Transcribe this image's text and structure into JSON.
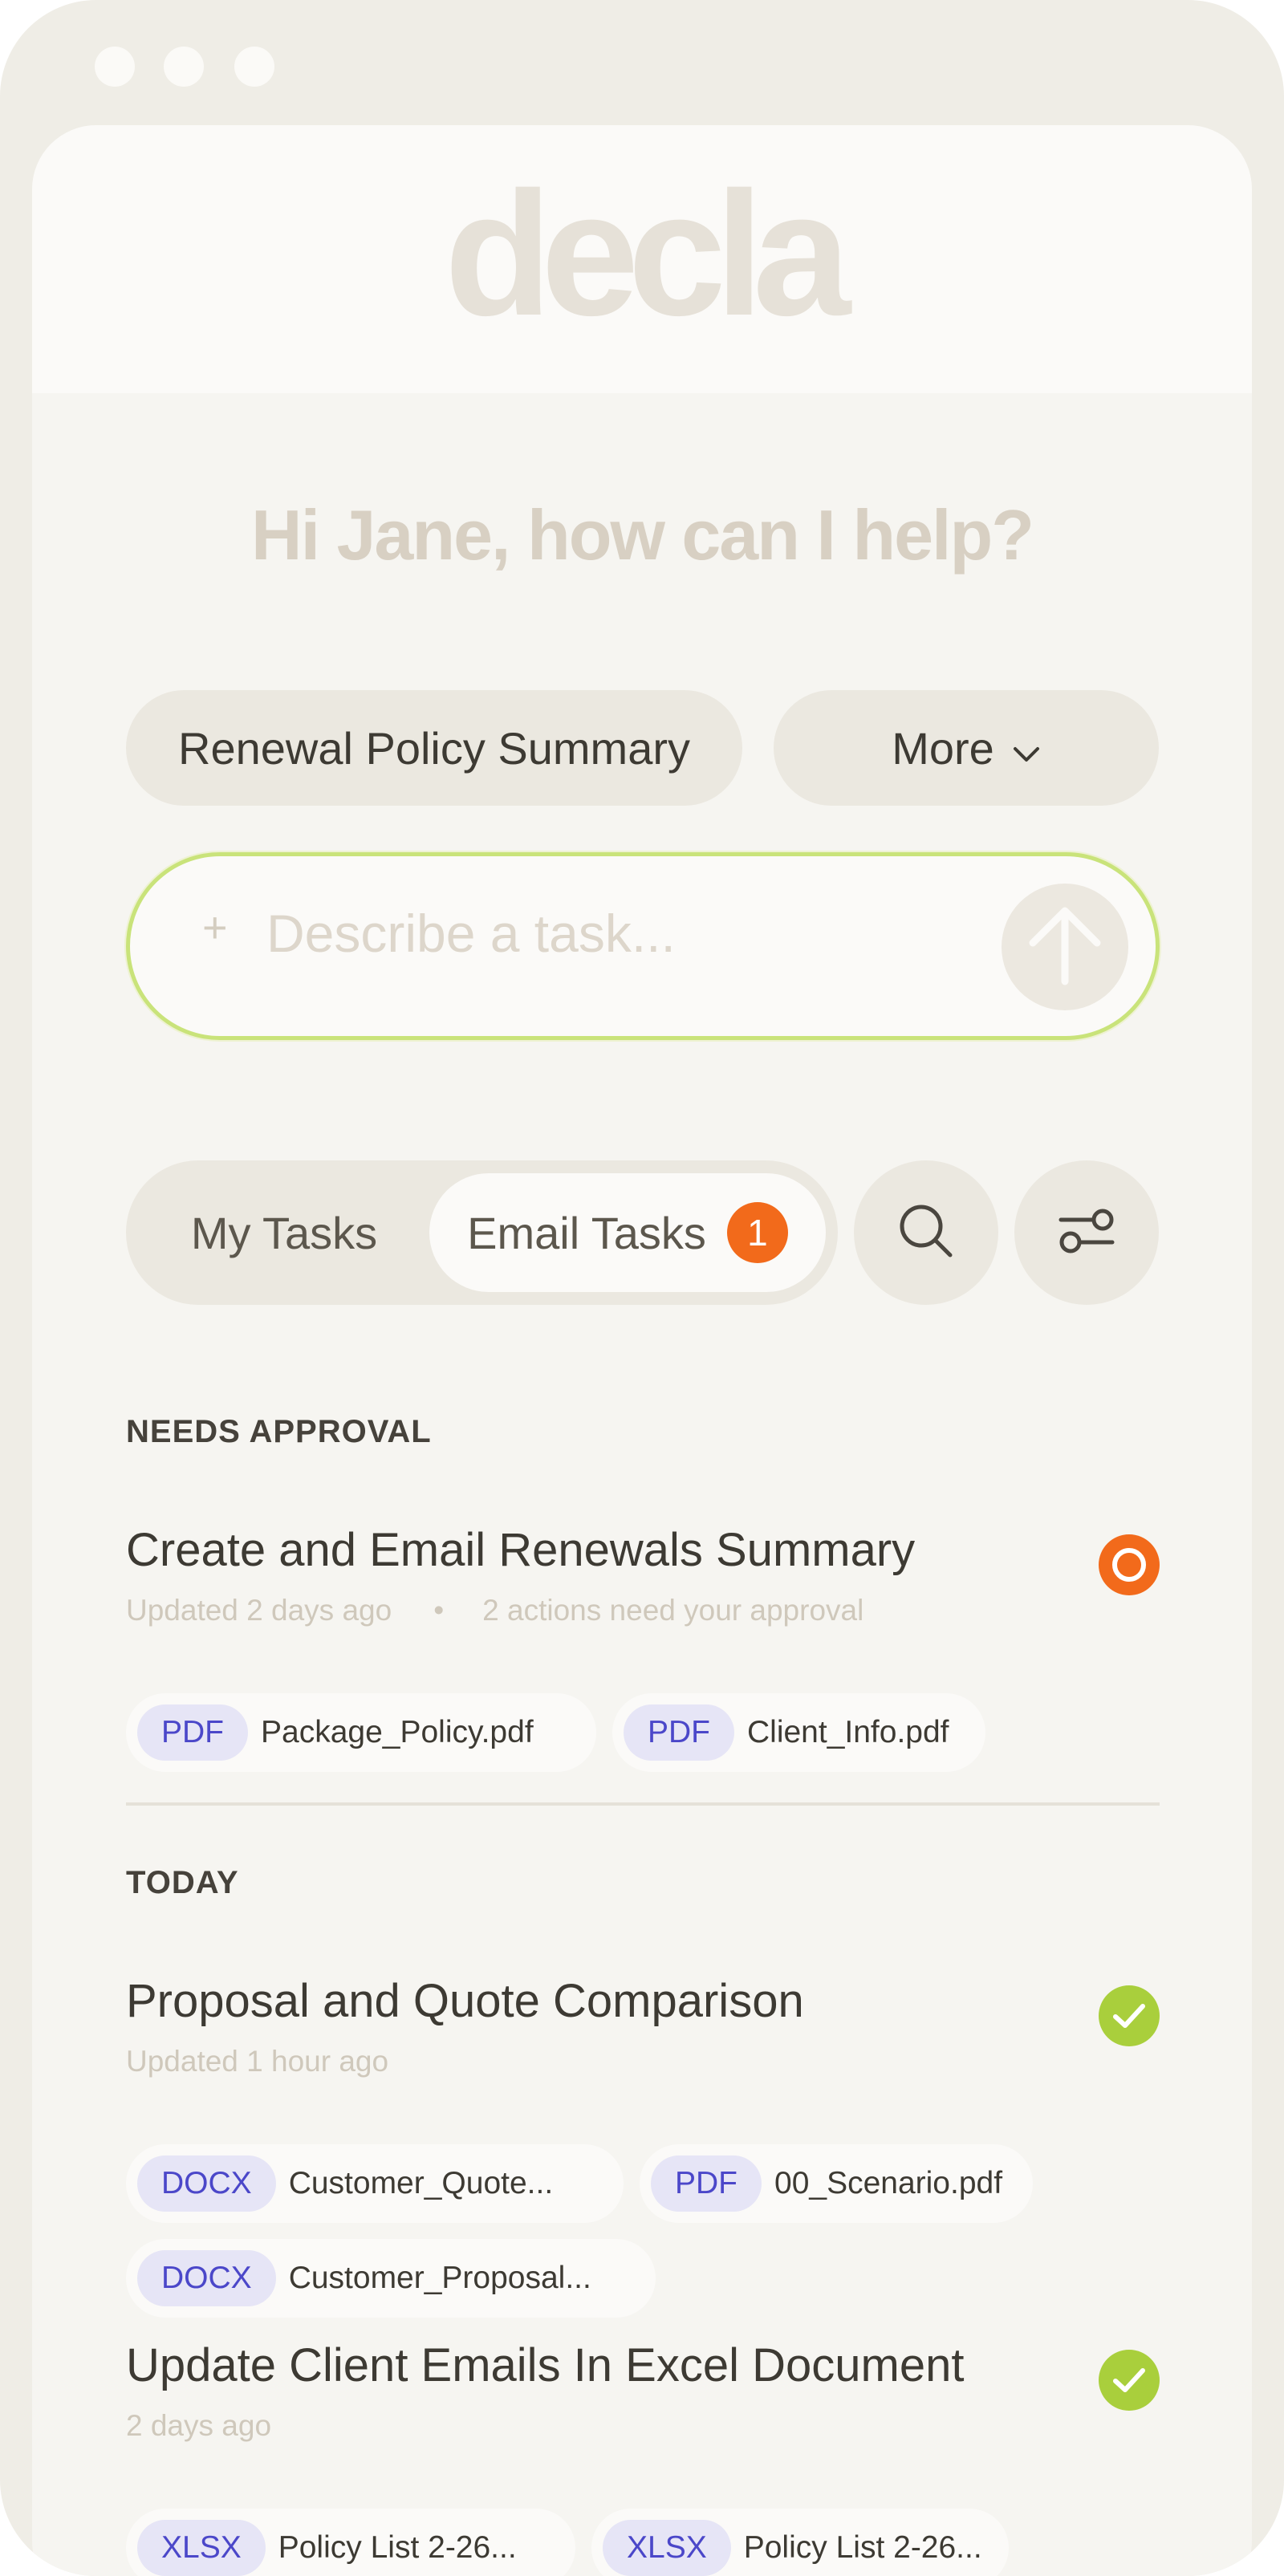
{
  "app": {
    "logo_text": "decla",
    "greeting": "Hi Jane, how can I help?"
  },
  "quick_actions": {
    "summary_label": "Renewal Policy Summary",
    "more_label": "More"
  },
  "task_input": {
    "placeholder": "Describe a task..."
  },
  "tabs": {
    "my_tasks": "My Tasks",
    "email_tasks": "Email Tasks",
    "email_badge": "1"
  },
  "icons": {
    "search": "search-icon",
    "filter": "sliders-icon",
    "send": "arrow-up-icon",
    "add": "plus-icon",
    "dropdown": "chevron-down-icon"
  },
  "colors": {
    "accent_orange": "#F26A1B",
    "accent_green": "#A9CF3C",
    "input_border": "#C9E37A",
    "file_type_text": "#4B47C9"
  },
  "sections": {
    "needs_approval": {
      "title": "NEEDS APPROVAL",
      "tasks": [
        {
          "title": "Create and Email Renewals Summary",
          "updated": "Updated 2 days ago",
          "separator": "•",
          "note": "2 actions need your approval",
          "status": "pending",
          "files": [
            {
              "type": "PDF",
              "name": "Package_Policy.pdf"
            },
            {
              "type": "PDF",
              "name": "Client_Info.pdf"
            }
          ]
        }
      ]
    },
    "today": {
      "title": "TODAY",
      "tasks": [
        {
          "title": "Proposal and Quote Comparison",
          "updated": "Updated 1 hour ago",
          "status": "done",
          "files": [
            {
              "type": "DOCX",
              "name": "Customer_Quote..."
            },
            {
              "type": "PDF",
              "name": "00_Scenario.pdf"
            },
            {
              "type": "DOCX",
              "name": "Customer_Proposal..."
            }
          ]
        },
        {
          "title": "Update Client Emails In Excel Document",
          "updated": "2 days ago",
          "status": "done",
          "files": [
            {
              "type": "XLSX",
              "name": "Policy List 2-26..."
            },
            {
              "type": "XLSX",
              "name": "Policy List 2-26..."
            }
          ]
        }
      ]
    }
  }
}
